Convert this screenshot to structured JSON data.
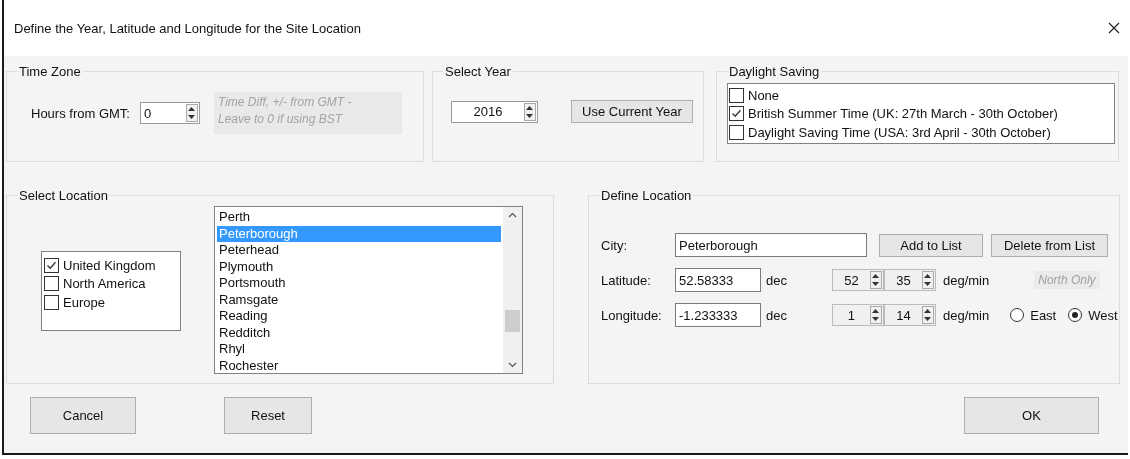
{
  "window": {
    "title": "Define the Year, Latitude and Longitude for the Site Location"
  },
  "time_zone": {
    "title": "Time Zone",
    "label": "Hours from GMT:",
    "value": "0",
    "hint": [
      "Time Diff,  +/-  from GMT -",
      "Leave to 0 if using BST"
    ]
  },
  "select_year": {
    "title": "Select Year",
    "value": "2016",
    "button": "Use Current Year"
  },
  "daylight_saving": {
    "title": "Daylight Saving",
    "options": [
      {
        "label": "None",
        "checked": false
      },
      {
        "label": "British Summer Time (UK: 27th March - 30th October)",
        "checked": true
      },
      {
        "label": "Daylight Saving Time (USA: 3rd April - 30th October)",
        "checked": false
      }
    ]
  },
  "select_location": {
    "title": "Select Location",
    "regions": [
      {
        "label": "United Kingdom",
        "checked": true
      },
      {
        "label": "North America",
        "checked": false
      },
      {
        "label": "Europe",
        "checked": false
      }
    ],
    "cities": [
      {
        "label": "Perth",
        "selected": false
      },
      {
        "label": "Peterborough",
        "selected": true
      },
      {
        "label": "Peterhead",
        "selected": false
      },
      {
        "label": "Plymouth",
        "selected": false
      },
      {
        "label": "Portsmouth",
        "selected": false
      },
      {
        "label": "Ramsgate",
        "selected": false
      },
      {
        "label": "Reading",
        "selected": false
      },
      {
        "label": "Redditch",
        "selected": false
      },
      {
        "label": "Rhyl",
        "selected": false
      },
      {
        "label": "Rochester",
        "selected": false
      }
    ]
  },
  "define_location": {
    "title": "Define Location",
    "city_label": "City:",
    "city": "Peterborough",
    "buttons": [
      "Add to List",
      "Delete from List"
    ],
    "latitude": {
      "label": "Latitude:",
      "dec": "52.58333",
      "dec_unit": "dec",
      "deg": "52",
      "min": "35",
      "deg_unit": "deg/min",
      "note": "North Only"
    },
    "longitude": {
      "label": "Longitude:",
      "dec": "-1.233333",
      "dec_unit": "dec",
      "deg": "1",
      "min": "14",
      "deg_unit": "deg/min",
      "hemispheres": [
        {
          "label": "East",
          "selected": false
        },
        {
          "label": "West",
          "selected": true
        }
      ]
    }
  },
  "buttons": [
    "Cancel",
    "Reset",
    "OK"
  ]
}
